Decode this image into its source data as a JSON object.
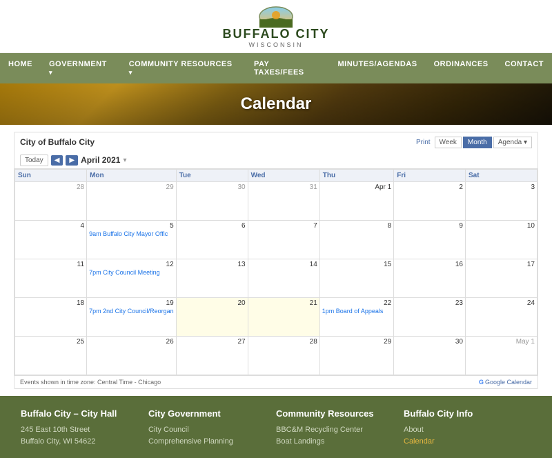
{
  "header": {
    "logo_alt": "Buffalo City Wisconsin Logo",
    "site_name": "BUFFALO CITY",
    "site_state": "WISCONSIN"
  },
  "nav": {
    "items": [
      {
        "label": "HOME",
        "has_dropdown": false
      },
      {
        "label": "GOVERNMENT",
        "has_dropdown": true
      },
      {
        "label": "COMMUNITY RESOURCES",
        "has_dropdown": true
      },
      {
        "label": "PAY TAXES/FEES",
        "has_dropdown": false
      },
      {
        "label": "MINUTES/AGENDAS",
        "has_dropdown": false
      },
      {
        "label": "ORDINANCES",
        "has_dropdown": false
      },
      {
        "label": "CONTACT",
        "has_dropdown": false
      }
    ]
  },
  "hero": {
    "title": "Calendar"
  },
  "calendar": {
    "owner": "City of Buffalo City",
    "today_label": "Today",
    "prev_label": "◀",
    "next_label": "▶",
    "month_year": "April 2021",
    "print_label": "Print",
    "views": [
      "Week",
      "Month",
      "Agenda"
    ],
    "active_view": "Month",
    "days_of_week": [
      "Sun",
      "Mon",
      "Tue",
      "Wed",
      "Thu",
      "Fri",
      "Sat"
    ],
    "weeks": [
      {
        "days": [
          {
            "num": "28",
            "in_month": false,
            "events": []
          },
          {
            "num": "29",
            "in_month": false,
            "events": []
          },
          {
            "num": "30",
            "in_month": false,
            "events": []
          },
          {
            "num": "31",
            "in_month": false,
            "events": []
          },
          {
            "num": "Apr 1",
            "in_month": true,
            "events": []
          },
          {
            "num": "2",
            "in_month": true,
            "events": []
          },
          {
            "num": "3",
            "in_month": true,
            "events": []
          }
        ]
      },
      {
        "days": [
          {
            "num": "4",
            "in_month": true,
            "events": []
          },
          {
            "num": "5",
            "in_month": true,
            "events": [
              {
                "label": "9am Buffalo City Mayor Offic",
                "color": "blue"
              }
            ]
          },
          {
            "num": "6",
            "in_month": true,
            "events": []
          },
          {
            "num": "7",
            "in_month": true,
            "events": []
          },
          {
            "num": "8",
            "in_month": true,
            "events": []
          },
          {
            "num": "9",
            "in_month": true,
            "events": []
          },
          {
            "num": "10",
            "in_month": true,
            "events": []
          }
        ]
      },
      {
        "days": [
          {
            "num": "11",
            "in_month": true,
            "events": []
          },
          {
            "num": "12",
            "in_month": true,
            "events": [
              {
                "label": "7pm City Council Meeting",
                "color": "blue"
              }
            ]
          },
          {
            "num": "13",
            "in_month": true,
            "events": []
          },
          {
            "num": "14",
            "in_month": true,
            "events": []
          },
          {
            "num": "15",
            "in_month": true,
            "events": []
          },
          {
            "num": "16",
            "in_month": true,
            "events": []
          },
          {
            "num": "17",
            "in_month": true,
            "events": []
          }
        ]
      },
      {
        "days": [
          {
            "num": "18",
            "in_month": true,
            "events": []
          },
          {
            "num": "19",
            "in_month": true,
            "events": [
              {
                "label": "7pm 2nd City Council/Reorgan",
                "color": "blue"
              }
            ]
          },
          {
            "num": "20",
            "in_month": true,
            "events": [],
            "highlight": true
          },
          {
            "num": "21",
            "in_month": true,
            "events": [],
            "highlight": true,
            "today": true
          },
          {
            "num": "22",
            "in_month": true,
            "events": [
              {
                "label": "1pm Board of Appeals",
                "color": "blue"
              }
            ]
          },
          {
            "num": "23",
            "in_month": true,
            "events": []
          },
          {
            "num": "24",
            "in_month": true,
            "events": []
          }
        ]
      },
      {
        "days": [
          {
            "num": "25",
            "in_month": true,
            "events": []
          },
          {
            "num": "26",
            "in_month": true,
            "events": []
          },
          {
            "num": "27",
            "in_month": true,
            "events": []
          },
          {
            "num": "28",
            "in_month": true,
            "events": []
          },
          {
            "num": "29",
            "in_month": true,
            "events": []
          },
          {
            "num": "30",
            "in_month": true,
            "events": []
          },
          {
            "num": "May 1",
            "in_month": false,
            "events": []
          }
        ]
      }
    ],
    "footer_timezone": "Events shown in time zone: Central Time - Chicago",
    "gcal_label": "Google Calendar"
  },
  "footer": {
    "col1": {
      "heading": "Buffalo City – City Hall",
      "address_line1": "245 East 10th Street",
      "address_line2": "Buffalo City, WI 54622"
    },
    "col2": {
      "heading": "City Government",
      "links": [
        "City Council",
        "Comprehensive Planning"
      ]
    },
    "col3": {
      "heading": "Community Resources",
      "links": [
        "BBC&M Recycling Center",
        "Boat Landings"
      ]
    },
    "col4": {
      "heading": "Buffalo City Info",
      "links": [
        {
          "label": "About",
          "gold": false
        },
        {
          "label": "Calendar",
          "gold": true
        }
      ]
    }
  }
}
